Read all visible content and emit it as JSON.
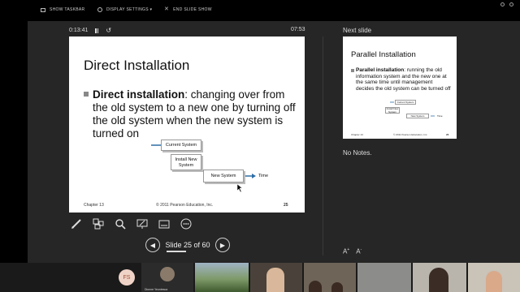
{
  "taskbar": {
    "show_taskbar": "SHOW TASKBAR",
    "display_settings": "DISPLAY SETTINGS ▾",
    "end_slide_show": "END SLIDE SHOW"
  },
  "presenter": {
    "timer": "0:13:41",
    "clock": "07:53",
    "next_label": "Next slide",
    "notes": "No Notes.",
    "slide_counter": "Slide 25 of 60"
  },
  "current_slide": {
    "title": "Direct Installation",
    "bullet_bold": "Direct installation",
    "bullet_rest": ": changing over from the old system to a new one by turning off the old system when the new system is turned on",
    "flow": {
      "current": "Current System",
      "install": "Install New System",
      "new": "New System",
      "time": "Time"
    },
    "footer_left": "Chapter 13",
    "footer_center": "© 2011 Pearson Education, Inc.",
    "footer_right": "25"
  },
  "next_slide": {
    "title": "Parallel Installation",
    "bullet_bold": "Parallel installation",
    "bullet_rest": ": running the old information system and the new one at the same time until management decides the old system can be turned off",
    "flow": {
      "current": "Current System",
      "install": "Install New System",
      "new": "New System",
      "time": "Time"
    },
    "footer_left": "Chapter 13",
    "footer_center": "© 2011 Pearson Education, Inc.",
    "footer_right": "26"
  },
  "gallery": {
    "avatar_initials": "FS",
    "participant_name": "Dionne Yeontesca"
  },
  "icons": [
    "pen-icon",
    "slides-grid-icon",
    "zoom-icon",
    "pointer-icon",
    "subtitles-icon",
    "more-icon",
    "prev-icon",
    "next-icon",
    "font-size-icon"
  ]
}
